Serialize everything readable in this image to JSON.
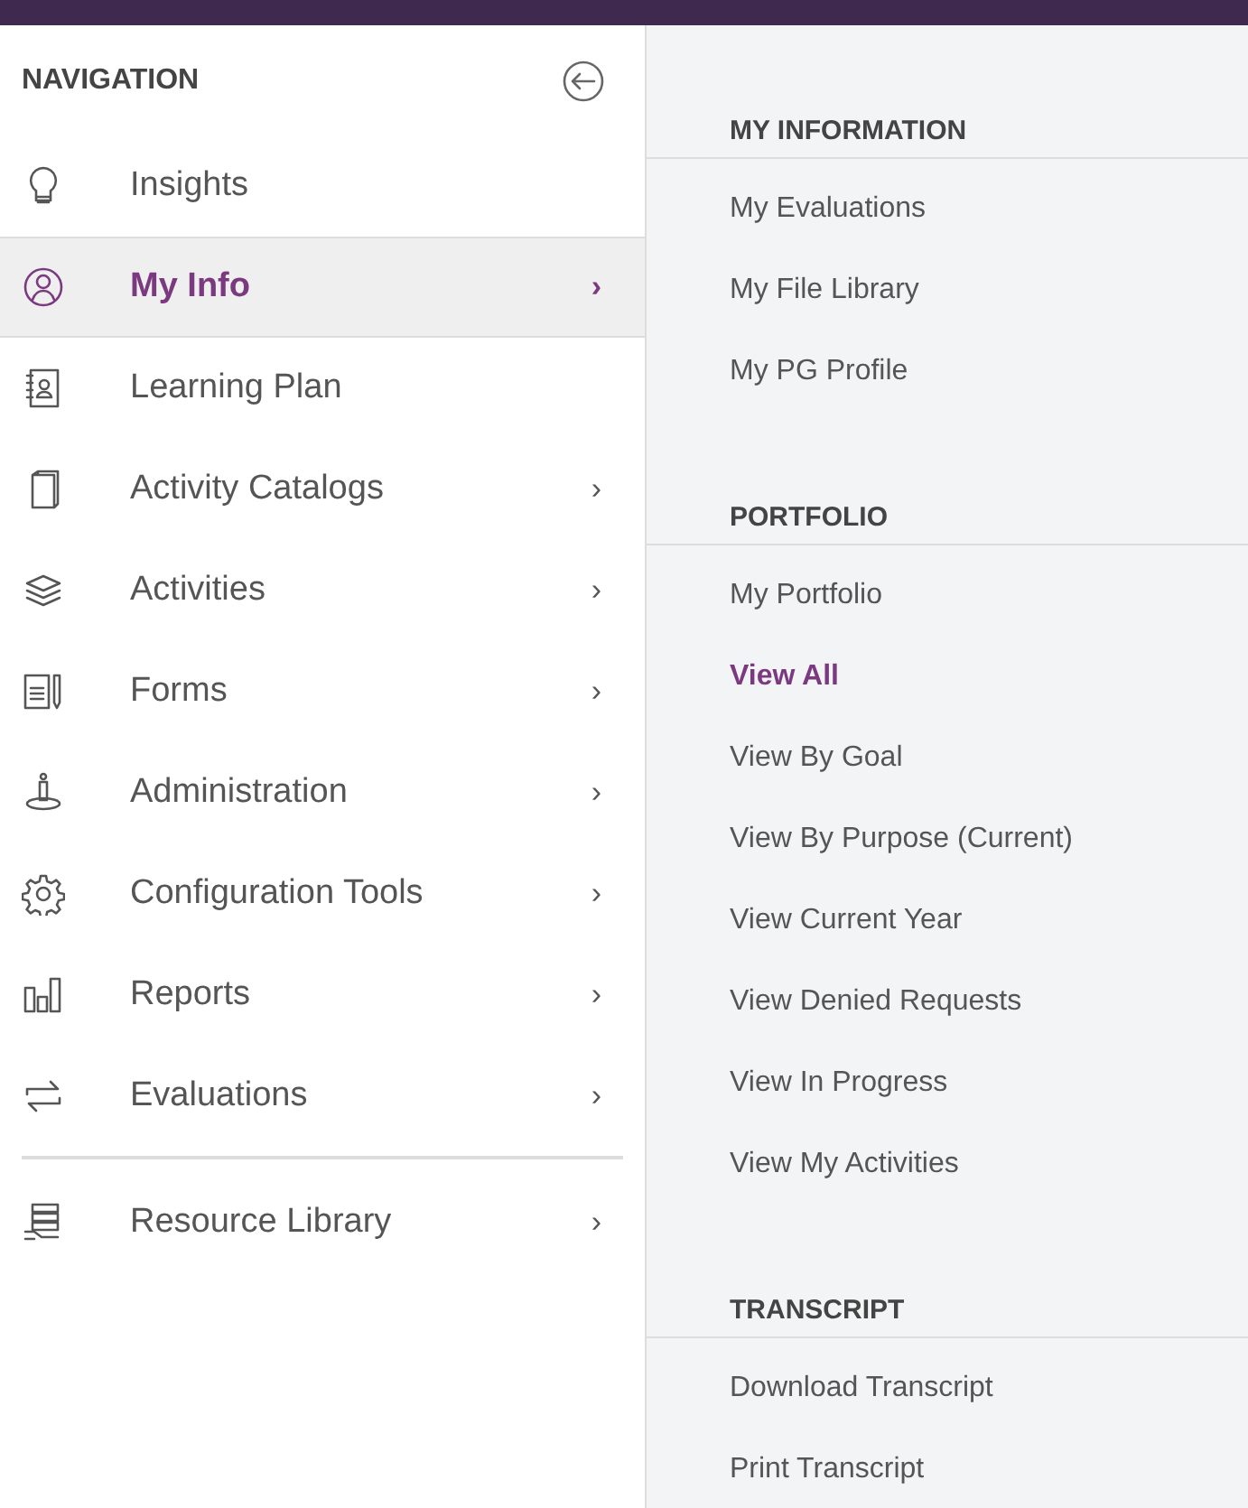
{
  "sidebar": {
    "heading": "NAVIGATION",
    "groups": [
      {
        "items": [
          {
            "label": "Insights",
            "selected": false
          },
          {
            "label": "My Info",
            "selected": true,
            "chevron": "›"
          },
          {
            "label": "Learning Plan",
            "selected": false
          },
          {
            "label": "Activity Catalogs",
            "selected": false,
            "chevron": "›"
          },
          {
            "label": "Activities",
            "selected": false,
            "chevron": "›"
          },
          {
            "label": "Forms",
            "selected": false,
            "chevron": "›"
          },
          {
            "label": "Administration",
            "selected": false,
            "chevron": "›"
          },
          {
            "label": "Configuration Tools",
            "selected": false,
            "chevron": "›"
          },
          {
            "label": "Reports",
            "selected": false,
            "chevron": "›"
          },
          {
            "label": "Evaluations",
            "selected": false,
            "chevron": "›"
          }
        ]
      },
      {
        "items": [
          {
            "label": "Resource Library",
            "selected": false,
            "chevron": "›"
          }
        ]
      }
    ]
  },
  "submenu": {
    "sections": [
      {
        "heading": "MY INFORMATION",
        "links": [
          {
            "label": "My Evaluations",
            "selected": false
          },
          {
            "label": "My File Library",
            "selected": false
          },
          {
            "label": "My PG Profile",
            "selected": false
          }
        ]
      },
      {
        "heading": "PORTFOLIO",
        "links": [
          {
            "label": "My Portfolio",
            "selected": false
          },
          {
            "label": "View All",
            "selected": true
          },
          {
            "label": "View By Goal",
            "selected": false
          },
          {
            "label": "View By Purpose (Current)",
            "selected": false
          },
          {
            "label": "View Current Year",
            "selected": false
          },
          {
            "label": "View Denied Requests",
            "selected": false
          },
          {
            "label": "View In Progress",
            "selected": false
          },
          {
            "label": "View My Activities",
            "selected": false
          }
        ]
      },
      {
        "heading": "TRANSCRIPT",
        "links": [
          {
            "label": "Download Transcript",
            "selected": false
          },
          {
            "label": "Print Transcript",
            "selected": false
          }
        ]
      }
    ]
  }
}
